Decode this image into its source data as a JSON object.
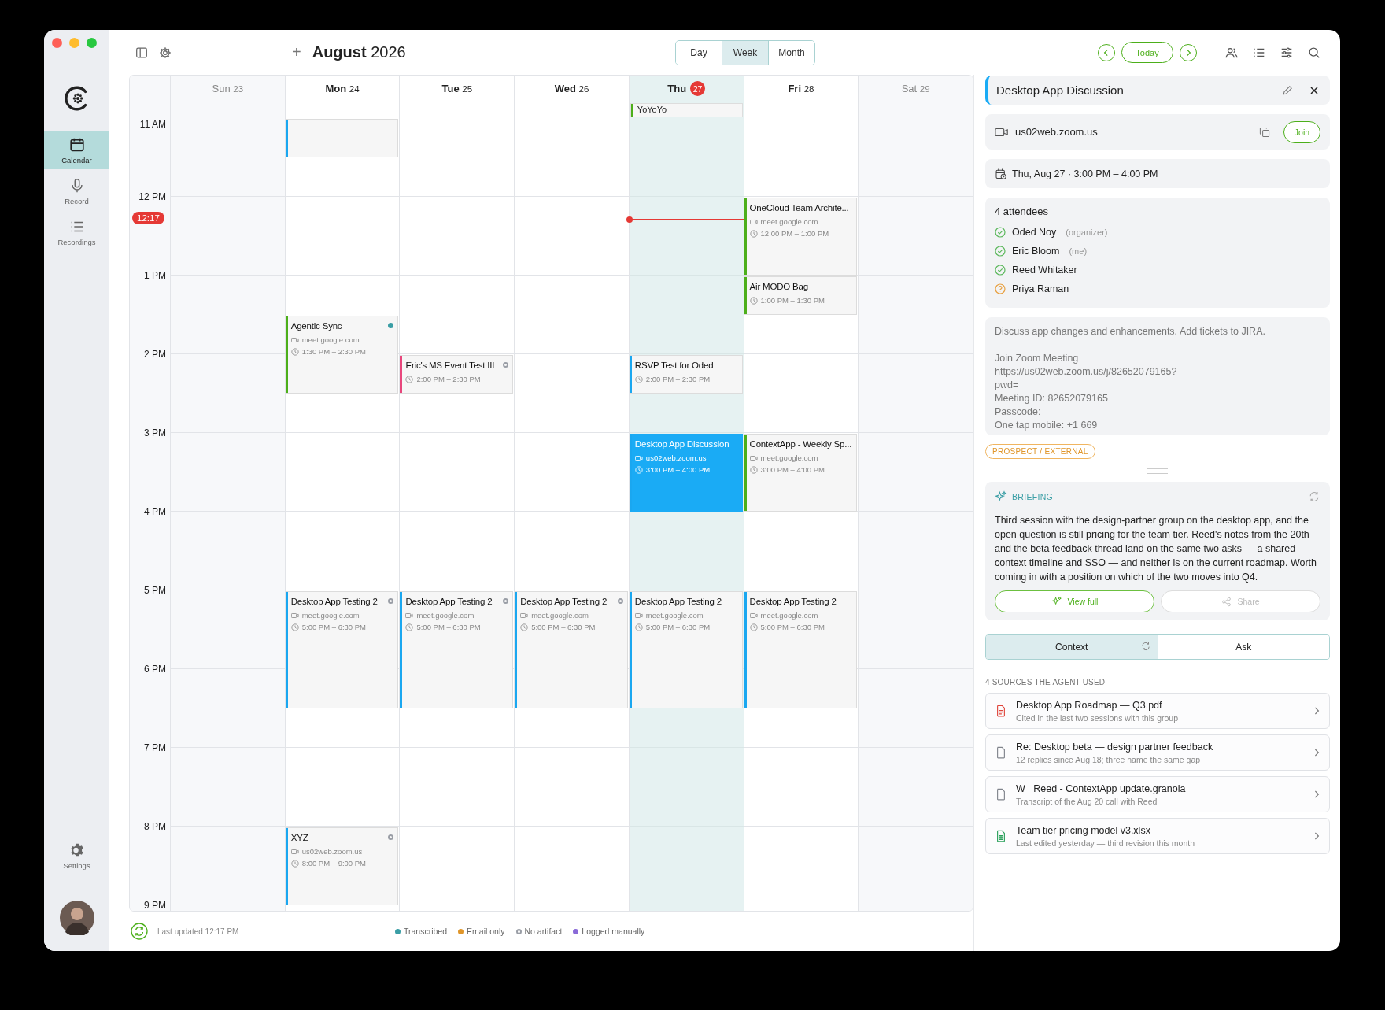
{
  "sidebar": {
    "items": [
      {
        "label": "Calendar",
        "kind": "calendar",
        "selected": true
      },
      {
        "label": "Record",
        "kind": "mic",
        "selected": false
      },
      {
        "label": "Recordings",
        "kind": "list",
        "selected": false
      }
    ],
    "settings": {
      "label": "Settings"
    }
  },
  "toolbar": {
    "add": "+",
    "title_bold": "August",
    "title_year": "2026",
    "views": [
      {
        "label": "Day",
        "selected": false
      },
      {
        "label": "Week",
        "selected": true
      },
      {
        "label": "Month",
        "selected": false
      }
    ],
    "today": "Today"
  },
  "calendar": {
    "days": [
      {
        "name": "Sun",
        "date": "23",
        "today": false,
        "weekend": true
      },
      {
        "name": "Mon",
        "date": "24",
        "today": false,
        "weekend": false,
        "events": [
          {
            "kind": "continued",
            "color": "#1aa7f0",
            "selected": false
          },
          {
            "kind": "event",
            "title": "Agentic Sync",
            "location": "meet.google.com",
            "time": "1:30 PM – 2:30 PM",
            "color": "#4caf1a",
            "status": {
              "color": "#3a9ea5",
              "hollow": false
            },
            "selected": false
          },
          {
            "kind": "event",
            "title": "Desktop App Testing 2",
            "location": "meet.google.com",
            "time": "5:00 PM – 6:30 PM",
            "color": "#1aa7f0",
            "status": {
              "color": "#9a9ea6",
              "hollow": true
            },
            "selected": false
          },
          {
            "kind": "event",
            "title": "XYZ",
            "location": "us02web.zoom.us",
            "time": "8:00 PM – 9:00 PM",
            "color": "#1aa7f0",
            "status": {
              "color": "#9a9ea6",
              "hollow": true
            },
            "selected": false
          }
        ]
      },
      {
        "name": "Tue",
        "date": "25",
        "today": false,
        "weekend": false,
        "events": [
          {
            "kind": "event",
            "title": "Eric's MS Event Test III",
            "time": "2:00 PM – 2:30 PM",
            "color": "#e8467c",
            "status": {
              "color": "#9a9ea6",
              "hollow": true
            },
            "selected": false
          },
          {
            "kind": "event",
            "title": "Desktop App Testing 2",
            "location": "meet.google.com",
            "time": "5:00 PM – 6:30 PM",
            "color": "#1aa7f0",
            "status": {
              "color": "#9a9ea6",
              "hollow": true
            },
            "selected": false
          }
        ]
      },
      {
        "name": "Wed",
        "date": "26",
        "today": false,
        "weekend": false,
        "events": [
          {
            "kind": "event",
            "title": "Desktop App Testing 2",
            "location": "meet.google.com",
            "time": "5:00 PM – 6:30 PM",
            "color": "#1aa7f0",
            "status": {
              "color": "#9a9ea6",
              "hollow": true
            },
            "selected": false
          }
        ]
      },
      {
        "name": "Thu",
        "date": "27",
        "today": true,
        "weekend": false,
        "allday": [
          {
            "title": "YoYoYo",
            "color": "#4caf1a"
          }
        ],
        "events": [
          {
            "kind": "event",
            "title": "RSVP Test for Oded",
            "time": "2:00 PM – 2:30 PM",
            "color": "#1aa7f0",
            "selected": false
          },
          {
            "kind": "event",
            "title": "Desktop App Discussion",
            "location": "us02web.zoom.us",
            "time": "3:00 PM – 4:00 PM",
            "color": "#1aa7f0",
            "selected": true
          },
          {
            "kind": "event",
            "title": "Desktop App Testing 2",
            "location": "meet.google.com",
            "time": "5:00 PM – 6:30 PM",
            "color": "#1aa7f0",
            "selected": false
          }
        ]
      },
      {
        "name": "Fri",
        "date": "28",
        "today": false,
        "weekend": false,
        "events": [
          {
            "kind": "event",
            "title": "OneCloud Team Archite...",
            "location": "meet.google.com",
            "time": "12:00 PM – 1:00 PM",
            "color": "#4caf1a",
            "selected": false
          },
          {
            "kind": "event",
            "title": "Air MODO Bag",
            "time": "1:00 PM – 1:30 PM",
            "color": "#4caf1a",
            "selected": false
          },
          {
            "kind": "event",
            "title": "ContextApp - Weekly Sp...",
            "location": "meet.google.com",
            "time": "3:00 PM – 4:00 PM",
            "color": "#4caf1a",
            "selected": false
          },
          {
            "kind": "event",
            "title": "Desktop App Testing 2",
            "location": "meet.google.com",
            "time": "5:00 PM – 6:30 PM",
            "color": "#1aa7f0",
            "selected": false
          }
        ]
      },
      {
        "name": "Sat",
        "date": "29",
        "today": false,
        "weekend": true
      }
    ],
    "hours": [
      "11 AM",
      "12 PM",
      "1 PM",
      "2 PM",
      "3 PM",
      "4 PM",
      "5 PM",
      "6 PM",
      "7 PM",
      "8 PM",
      "9 PM"
    ],
    "now": "12:17"
  },
  "status_bar": {
    "updated": "Last updated 12:17 PM",
    "legend": [
      {
        "label": "Transcribed",
        "kind": "dot",
        "color": "#3a9ea5"
      },
      {
        "label": "Email only",
        "kind": "dot",
        "color": "#e0962a"
      },
      {
        "label": "No artifact",
        "kind": "ring",
        "color": "#9a9ea6"
      },
      {
        "label": "Logged manually",
        "kind": "dot",
        "color": "#8a6ad8"
      }
    ]
  },
  "detail": {
    "title": "Desktop App Discussion",
    "link": "us02web.zoom.us",
    "join": "Join",
    "when": "Thu, Aug 27 · 3:00 PM – 4:00 PM",
    "attendees_title": "4 attendees",
    "attendees": [
      {
        "name": "Oded Noy",
        "note": "(organizer)",
        "accepted": true
      },
      {
        "name": "Eric Bloom",
        "note": "(me)",
        "accepted": true
      },
      {
        "name": "Reed Whitaker",
        "accepted": true
      },
      {
        "name": "Priya Raman",
        "accepted": false
      }
    ],
    "description": [
      [
        "Discuss app changes and enhancements. Add tickets to JIRA."
      ],
      [
        "Join Zoom Meeting",
        "https://us02web.zoom.us/j/82652079165?",
        "pwd=",
        "Meeting ID: 82652079165",
        "Passcode:",
        "One tap mobile: +1 669"
      ]
    ],
    "tag": "PROSPECT / EXTERNAL",
    "briefing": {
      "title": "BRIEFING",
      "text": "Third session with the design-partner group on the desktop app, and the open question is still pricing for the team tier. Reed's notes from the 20th and the beta feedback thread land on the same two asks — a shared context timeline and SSO — and neither is on the current roadmap. Worth coming in with a position on which of the two moves into Q4.",
      "view": "View full",
      "share": "Share"
    },
    "tabs": [
      {
        "label": "Context",
        "selected": true
      },
      {
        "label": "Ask",
        "selected": false
      }
    ],
    "sources_title": "4 SOURCES THE AGENT USED",
    "sources": [
      {
        "title": "Desktop App Roadmap — Q3.pdf",
        "subtitle": "Cited in the last two sessions with this group",
        "kind": "pdf"
      },
      {
        "title": "Re: Desktop beta — design partner feedback",
        "subtitle": "12 replies since Aug 18; three name the same gap",
        "kind": "doc"
      },
      {
        "title": "W_ Reed - ContextApp update.granola",
        "subtitle": "Transcript of the Aug 20 call with Reed",
        "kind": "doc"
      },
      {
        "title": "Team tier pricing model v3.xlsx",
        "subtitle": "Last edited yesterday — third revision this month",
        "kind": "sheet"
      }
    ]
  }
}
